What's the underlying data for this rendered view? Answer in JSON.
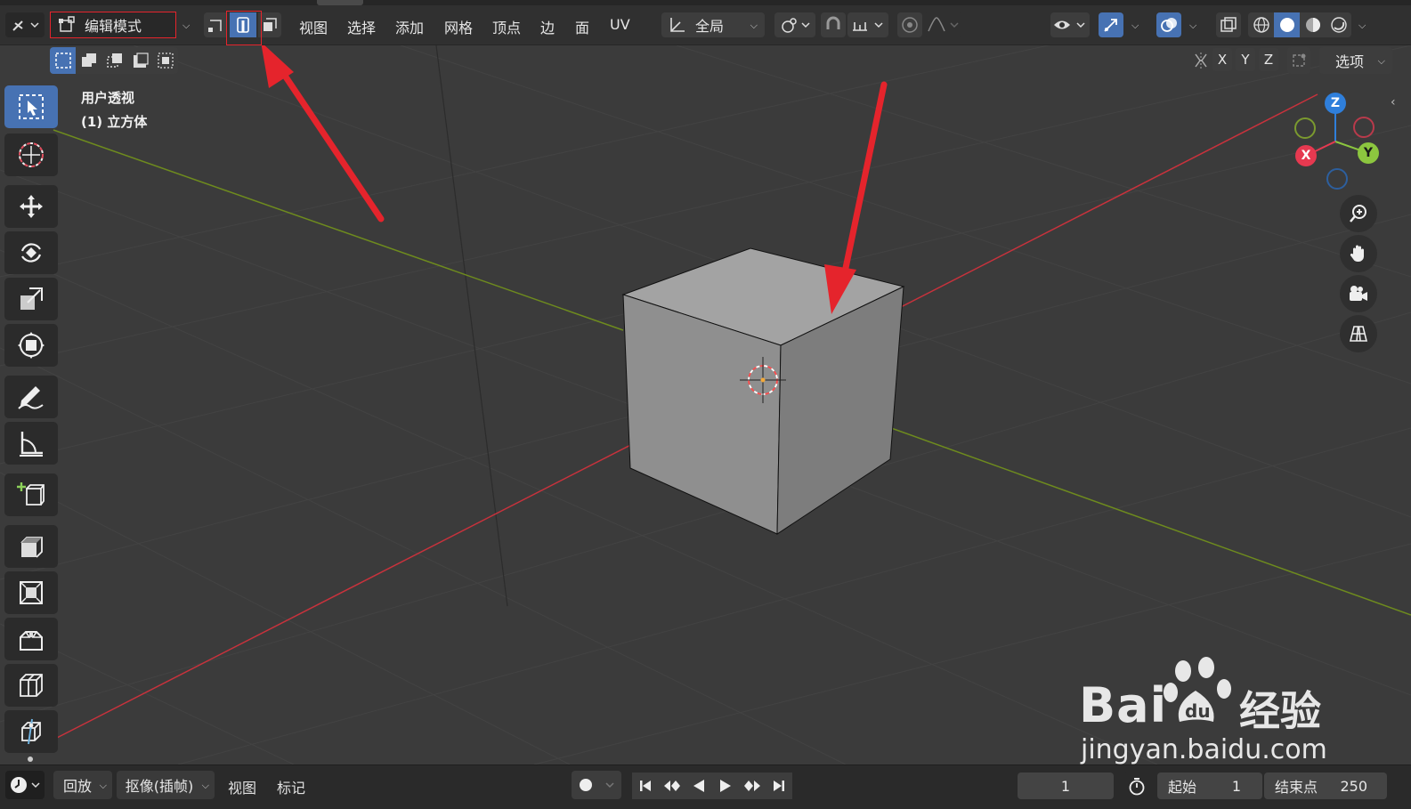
{
  "header": {
    "mode_label": "编辑模式",
    "menus": [
      "视图",
      "选择",
      "添加",
      "网格",
      "顶点",
      "边",
      "面",
      "UV"
    ],
    "transform_orientation": "全局",
    "options_label": "选项",
    "axis_x": "X",
    "axis_y": "Y",
    "axis_z": "Z"
  },
  "viewport": {
    "view_name": "用户透视",
    "object_name": "(1) 立方体"
  },
  "gizmo": {
    "x": "X",
    "y": "Y",
    "z": "Z"
  },
  "timeline": {
    "playback_label": "回放",
    "keying_label": "抠像(插帧)",
    "view_label": "视图",
    "marker_label": "标记",
    "current_frame": "1",
    "start_label": "起始",
    "start_value": "1",
    "end_label": "结束点",
    "end_value": "250"
  },
  "watermark": {
    "brand": "Bai",
    "brand_suffix": "经验",
    "url": "jingyan.baidu.com"
  },
  "colors": {
    "accent": "#4772b3",
    "annotation_red": "#e5242c",
    "axis_x_red": "#c8323c",
    "axis_y_green": "#6e8b1e",
    "gizmo_z": "#2f7fdb",
    "gizmo_y": "#8cc63f",
    "gizmo_x": "#e63950"
  }
}
